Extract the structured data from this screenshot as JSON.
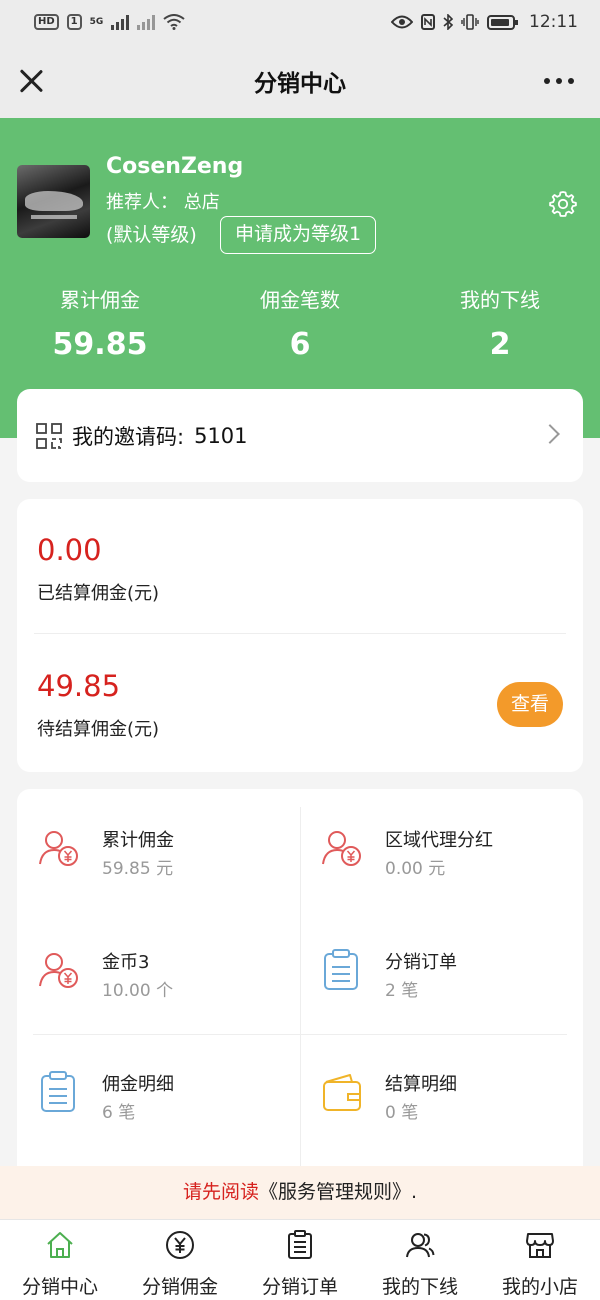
{
  "status_bar": {
    "time": "12:11",
    "hd_label": "HD",
    "sim_label": "1",
    "network_label": "5G"
  },
  "nav": {
    "title": "分销中心"
  },
  "profile": {
    "name": "CosenZeng",
    "referrer": "推荐人： 总店",
    "level": "(默认等级)",
    "apply_button": "申请成为等级1"
  },
  "stats": [
    {
      "label": "累计佣金",
      "value": "59.85"
    },
    {
      "label": "佣金笔数",
      "value": "6"
    },
    {
      "label": "我的下线",
      "value": "2"
    }
  ],
  "invite": {
    "label": "我的邀请码:",
    "code": "5101"
  },
  "settlement": {
    "settled_amount": "0.00",
    "settled_label": "已结算佣金(元)",
    "pending_amount": "49.85",
    "pending_label": "待结算佣金(元)",
    "view_button": "查看"
  },
  "grid": [
    {
      "title": "累计佣金",
      "sub": "59.85 元",
      "icon": "user-yuan-icon"
    },
    {
      "title": "区域代理分红",
      "sub": "0.00 元",
      "icon": "user-yuan-icon"
    },
    {
      "title": "金币3",
      "sub": "10.00 个",
      "icon": "user-yuan-icon"
    },
    {
      "title": "分销订单",
      "sub": "2 笔",
      "icon": "clipboard-icon"
    },
    {
      "title": "佣金明细",
      "sub": "6 笔",
      "icon": "clipboard-icon"
    },
    {
      "title": "结算明细",
      "sub": "0 笔",
      "icon": "wallet-icon"
    }
  ],
  "notice": {
    "prefix": "请先阅读",
    "link": "《服务管理规则》",
    "suffix": "."
  },
  "tabs": [
    {
      "label": "分销中心",
      "icon": "home-icon"
    },
    {
      "label": "分销佣金",
      "icon": "yuan-circle-icon"
    },
    {
      "label": "分销订单",
      "icon": "order-list-icon"
    },
    {
      "label": "我的下线",
      "icon": "users-icon"
    },
    {
      "label": "我的小店",
      "icon": "shop-icon"
    }
  ],
  "colors": {
    "header_green": "#64bf72",
    "amount_red": "#d6221e",
    "button_orange": "#f39a2a",
    "active_tab": "#4caf50",
    "icon_red": "#e05a5a",
    "icon_blue": "#6aa8d8",
    "icon_yellow": "#f0b429"
  }
}
